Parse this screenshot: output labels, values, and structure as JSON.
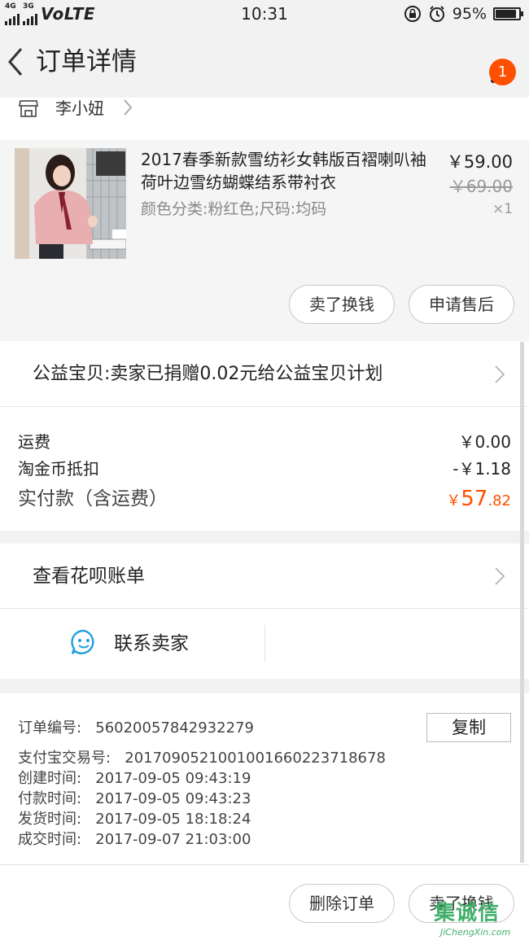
{
  "status_bar": {
    "net_top": "4G",
    "net_bottom": "3G",
    "volte": "VoLTE",
    "time": "10:31",
    "battery_percent": "95%",
    "battery_level": 0.95
  },
  "header": {
    "back_glyph": "〈",
    "title": "订单详情",
    "badge_count": "1"
  },
  "shop": {
    "name": "李小妞",
    "arrow": "〉"
  },
  "item": {
    "title": "2017春季新款雪纺衫女韩版百褶喇叭袖荷叶边雪纺蝴蝶结系带衬衣",
    "spec": "颜色分类:粉红色;尺码:均码",
    "price": "￥59.00",
    "original_price": "￥69.00",
    "quantity": "×1",
    "btn_sell": "卖了换钱",
    "btn_aftersale": "申请售后"
  },
  "charity": {
    "text": "公益宝贝:卖家已捐赠0.02元给公益宝贝计划"
  },
  "costs": {
    "shipping_label": "运费",
    "shipping_value": "￥0.00",
    "coin_label": "淘金币抵扣",
    "coin_value": "-￥1.18",
    "total_label": "实付款（含运费）",
    "total_currency": "￥",
    "total_int": "57",
    "total_dec": ".82"
  },
  "huabei": {
    "text": "查看花呗账单"
  },
  "contact": {
    "text": "联系卖家"
  },
  "order_info": {
    "copy_label": "复制",
    "rows": [
      {
        "label": "订单编号:",
        "value": "56020057842932279"
      },
      {
        "label": "支付宝交易号:",
        "value": "2017090521001001660223718678"
      },
      {
        "label": "创建时间:",
        "value": "2017-09-05 09:43:19"
      },
      {
        "label": "付款时间:",
        "value": "2017-09-05 09:43:23"
      },
      {
        "label": "发货时间:",
        "value": "2017-09-05 18:18:24"
      },
      {
        "label": "成交时间:",
        "value": "2017-09-07 21:03:00"
      }
    ]
  },
  "bottom_bar": {
    "delete_label": "删除订单",
    "sell_label": "卖了换钱"
  },
  "watermark": {
    "main": "集诚信",
    "sub": "JiChengXin.com"
  },
  "colors": {
    "accent": "#ff5000",
    "contact_icon": "#1e9ee0",
    "watermark": "#41b06b"
  }
}
